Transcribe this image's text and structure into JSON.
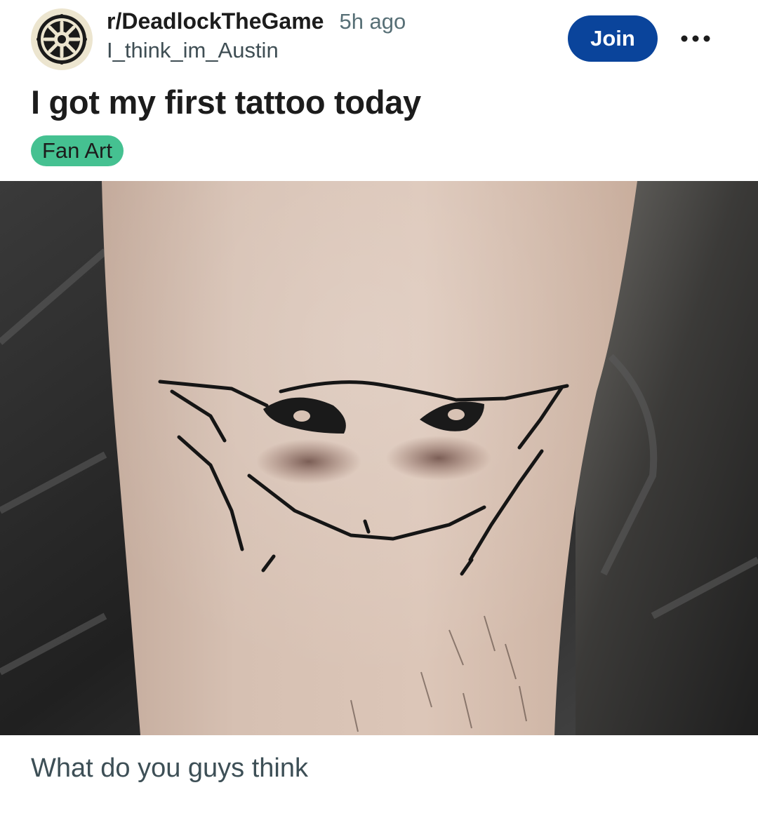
{
  "post": {
    "subreddit": "r/DeadlockTheGame",
    "time_ago": "5h ago",
    "author": "I_think_im_Austin",
    "join_label": "Join",
    "more_icon": "more-horizontal-icon",
    "title": "I got my first tattoo today",
    "flair": "Fan Art",
    "body": "What do you guys think"
  },
  "colors": {
    "join_button": "#0a449b",
    "flair_background": "#45c191",
    "meta_text": "#576f76",
    "avatar_background": "#ece5cf"
  },
  "icons": {
    "avatar": "wheel-logo-icon",
    "more": "more-horizontal-icon"
  }
}
